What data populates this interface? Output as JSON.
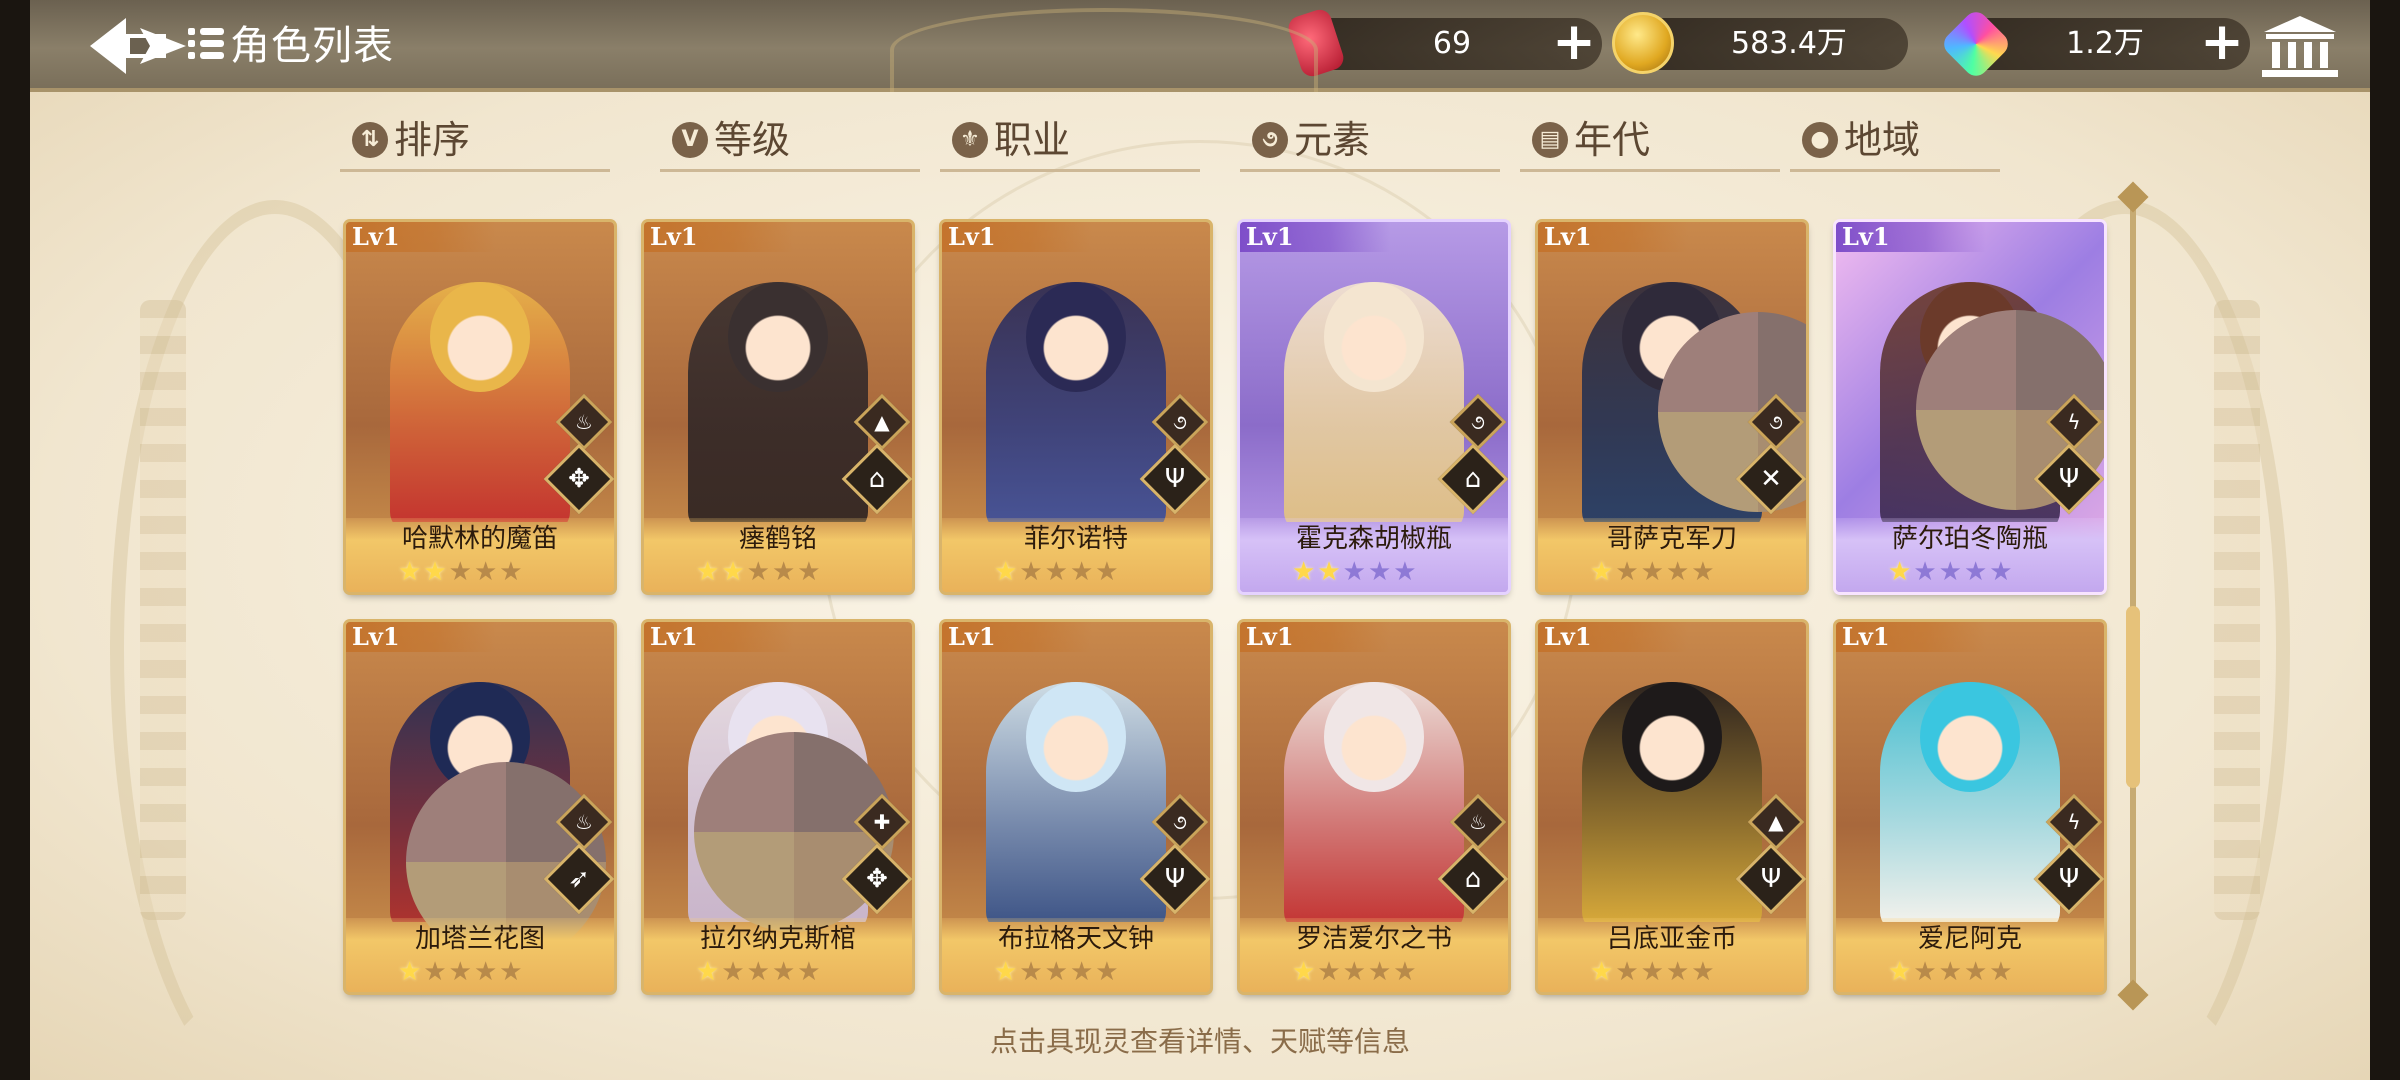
{
  "header": {
    "title": "角色列表",
    "resources": [
      {
        "id": "stamina",
        "icon": "drink-can-icon",
        "value": "69"
      },
      {
        "id": "gold",
        "icon": "gold-coin-icon",
        "value": "583.4万"
      },
      {
        "id": "gem",
        "icon": "rainbow-gem-icon",
        "value": "1.2万"
      }
    ]
  },
  "tabs": [
    {
      "label": "排序",
      "icon": "sort-icon",
      "glyph": "⇅"
    },
    {
      "label": "等级",
      "icon": "level-v-icon",
      "glyph": "V"
    },
    {
      "label": "职业",
      "icon": "job-icon",
      "glyph": "⚜"
    },
    {
      "label": "元素",
      "icon": "element-swirl-icon",
      "glyph": "૭"
    },
    {
      "label": "年代",
      "icon": "calendar-icon",
      "glyph": "▤"
    },
    {
      "label": "地域",
      "icon": "location-pin-icon",
      "glyph": "●"
    }
  ],
  "cards": [
    {
      "level": "Lv1",
      "name": "哈默林的魔笛",
      "stars": 2,
      "rarity": "gold",
      "element": "fire-icon",
      "class": "support-class-icon",
      "palette": [
        "#e9b64a",
        "#c3262b"
      ]
    },
    {
      "level": "Lv1",
      "name": "瘗鹤铭",
      "stars": 2,
      "rarity": "gold",
      "element": "earth-icon",
      "class": "book-class-icon",
      "palette": [
        "#3a3030",
        "#2a2020"
      ]
    },
    {
      "level": "Lv1",
      "name": "菲尔诺特",
      "stars": 1,
      "rarity": "gold",
      "element": "wind-icon",
      "class": "trident-class-icon",
      "palette": [
        "#2b2a55",
        "#3b4fa0"
      ]
    },
    {
      "level": "Lv1",
      "name": "霍克森胡椒瓶",
      "stars": 2,
      "rarity": "purple",
      "element": "wind-icon",
      "class": "book-class-icon",
      "palette": [
        "#f4e5d0",
        "#e3c27a"
      ]
    },
    {
      "level": "Lv1",
      "name": "哥萨克军刀",
      "stars": 1,
      "rarity": "gold",
      "element": "wind-icon",
      "class": "swords-class-icon",
      "palette": [
        "#2f2a3a",
        "#1c3a6b"
      ]
    },
    {
      "level": "Lv1",
      "name": "萨尔珀冬陶瓶",
      "stars": 1,
      "rarity": "iris",
      "element": "thunder-icon",
      "class": "trident-class-icon",
      "palette": [
        "#6b3a2a",
        "#3a2a55"
      ]
    },
    {
      "level": "Lv1",
      "name": "加塔兰花图",
      "stars": 1,
      "rarity": "gold",
      "element": "fire-icon",
      "class": "bow-class-icon",
      "palette": [
        "#1f2a55",
        "#b02a2a"
      ]
    },
    {
      "level": "Lv1",
      "name": "拉尔纳克斯棺",
      "stars": 1,
      "rarity": "gold",
      "element": "light-icon",
      "class": "support-class-icon",
      "palette": [
        "#e8e2f0",
        "#c9b9d8"
      ]
    },
    {
      "level": "Lv1",
      "name": "布拉格天文钟",
      "stars": 1,
      "rarity": "gold",
      "element": "wind-icon",
      "class": "trident-class-icon",
      "palette": [
        "#cfe6f5",
        "#2a4a8a"
      ]
    },
    {
      "level": "Lv1",
      "name": "罗洁爱尔之书",
      "stars": 1,
      "rarity": "gold",
      "element": "fire-icon",
      "class": "book-class-icon",
      "palette": [
        "#f0e6e6",
        "#c2262b"
      ]
    },
    {
      "level": "Lv1",
      "name": "吕底亚金币",
      "stars": 1,
      "rarity": "gold",
      "element": "earth-icon",
      "class": "trident-class-icon",
      "palette": [
        "#1e1a1a",
        "#e0b23a"
      ]
    },
    {
      "level": "Lv1",
      "name": "爱尼阿克",
      "stars": 1,
      "rarity": "gold",
      "element": "thunder-icon",
      "class": "trident-class-icon",
      "palette": [
        "#3ac6e0",
        "#ffffff"
      ]
    }
  ],
  "hint": "点击具现灵查看详情、天赋等信息",
  "colors": {
    "header_bg": "#7a6f5a",
    "panel_bg": "#f6eedc",
    "tab_text": "#5c4732",
    "gold_card": "#c9894c",
    "purple_card": "#8b6cc9",
    "star_on": "#ffd84a"
  }
}
